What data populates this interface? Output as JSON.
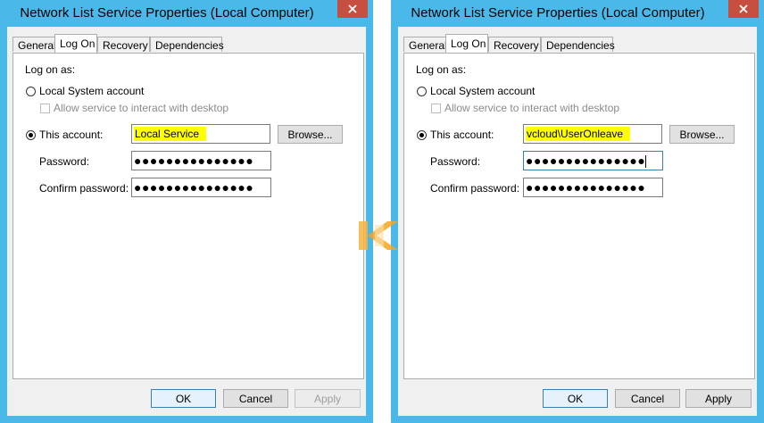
{
  "dialogs": [
    {
      "title": "Network List Service Properties (Local Computer)",
      "tabs": [
        "General",
        "Log On",
        "Recovery",
        "Dependencies"
      ],
      "active_tab": "Log On",
      "log_on_as_label": "Log on as:",
      "local_system_label": "Local System account",
      "allow_interact_label": "Allow service to interact with desktop",
      "this_account_label": "This account:",
      "account_value": "Local Service",
      "browse_label": "Browse...",
      "password_label": "Password:",
      "password_value": "●●●●●●●●●●●●●●●",
      "confirm_label": "Confirm password:",
      "confirm_value": "●●●●●●●●●●●●●●●",
      "ok_label": "OK",
      "cancel_label": "Cancel",
      "apply_label": "Apply"
    },
    {
      "title": "Network List Service Properties (Local Computer)",
      "tabs": [
        "General",
        "Log On",
        "Recovery",
        "Dependencies"
      ],
      "active_tab": "Log On",
      "log_on_as_label": "Log on as:",
      "local_system_label": "Local System account",
      "allow_interact_label": "Allow service to interact with desktop",
      "this_account_label": "This account:",
      "account_value": "vcloud\\UserOnleave",
      "browse_label": "Browse...",
      "password_label": "Password:",
      "password_value": "●●●●●●●●●●●●●●●",
      "confirm_label": "Confirm password:",
      "confirm_value": "●●●●●●●●●●●●●●●",
      "ok_label": "OK",
      "cancel_label": "Cancel",
      "apply_label": "Apply"
    }
  ],
  "colors": {
    "window_frame": "#4ab9e9",
    "close_button": "#c74f3f",
    "highlight": "#ffff00",
    "watermark": "#f5a623"
  },
  "icons": [
    "close-icon",
    "watermark-logo"
  ]
}
